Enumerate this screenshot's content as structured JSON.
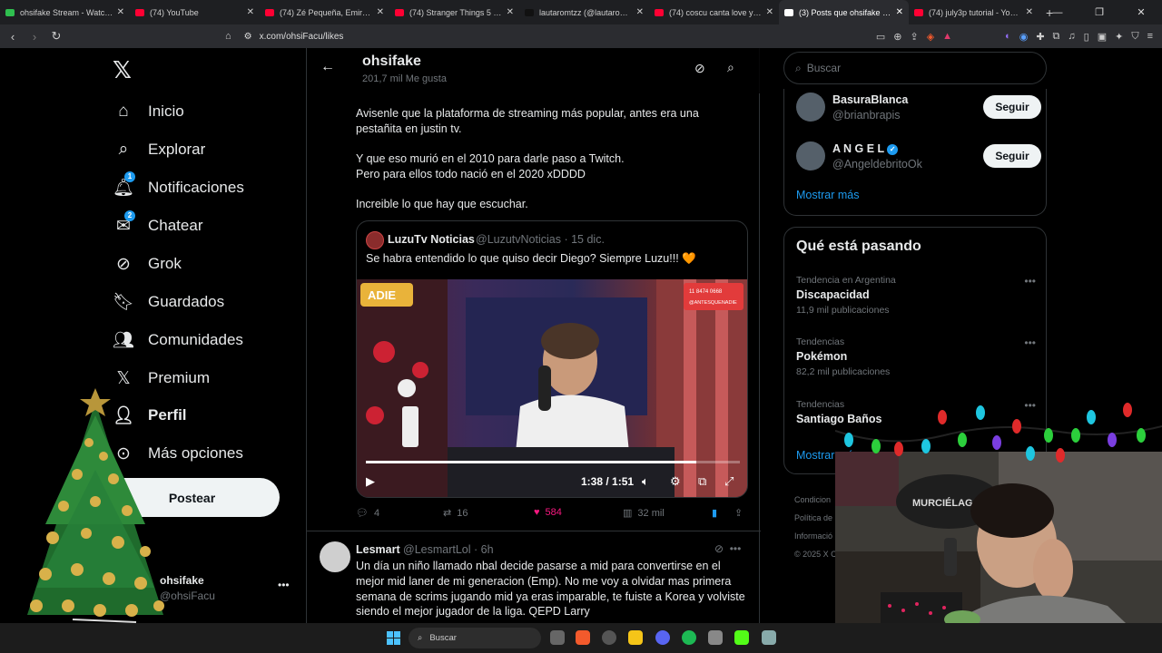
{
  "browser": {
    "tabs": [
      {
        "title": "ohsifake Stream - Watch Li",
        "color": "#2fbf4f",
        "active": false
      },
      {
        "title": "(74) YouTube",
        "color": "#ff0033",
        "active": false
      },
      {
        "title": "(74) Zé Pequeña, Emirsito - TW",
        "color": "#ff0033",
        "active": false
      },
      {
        "title": "(74) Stranger Things 5 | Tráiler",
        "color": "#ff0033",
        "active": false
      },
      {
        "title": "lautaromtzz (@lautaromtzz) | T",
        "color": "#111111",
        "active": false
      },
      {
        "title": "(74) coscu canta love yourself",
        "color": "#ff0033",
        "active": false
      },
      {
        "title": "(3) Posts que ohsifake (@o",
        "color": "#ffffff",
        "active": true
      },
      {
        "title": "(74) july3p tutorial - YouTube",
        "color": "#ff0033",
        "active": false
      }
    ],
    "url": "x.com/ohsiFacu/likes"
  },
  "nav": {
    "items": [
      {
        "label": "Inicio",
        "icon": "home-icon",
        "badge": ""
      },
      {
        "label": "Explorar",
        "icon": "search-icon",
        "badge": ""
      },
      {
        "label": "Notificaciones",
        "icon": "bell-icon",
        "badge": "1"
      },
      {
        "label": "Chatear",
        "icon": "mail-icon",
        "badge": "2"
      },
      {
        "label": "Grok",
        "icon": "grok-icon",
        "badge": ""
      },
      {
        "label": "Guardados",
        "icon": "bookmark-icon",
        "badge": ""
      },
      {
        "label": "Comunidades",
        "icon": "people-icon",
        "badge": ""
      },
      {
        "label": "Premium",
        "icon": "x-icon",
        "badge": ""
      },
      {
        "label": "Perfil",
        "icon": "person-icon",
        "badge": ""
      },
      {
        "label": "Más opciones",
        "icon": "more-circle-icon",
        "badge": ""
      }
    ],
    "post_label": "Postear",
    "account": {
      "name": "ohsifake",
      "handle": "@ohsiFacu"
    }
  },
  "header": {
    "title": "ohsifake",
    "subtitle": "201,7 mil Me gusta"
  },
  "tweet1": {
    "lines": [
      "Avisenle que la plataforma de streaming más popular, antes era una",
      "pestañita en justin tv.",
      "",
      "Y que eso murió en el 2010 para darle paso a Twitch.",
      "Pero para ellos todo nació en el 2020 xDDDD",
      "",
      "Increible lo que hay que escuchar."
    ],
    "quote": {
      "name": "LuzuTv Noticias",
      "handle": "@LuzutvNoticias · 15 dic.",
      "text": "Se habra entendido lo que quiso decir Diego? Siempre Luzu!!! 🧡",
      "video_time": "1:38 / 1:51",
      "video_progress": 0.883,
      "overlay_phone": "11 8474 0668",
      "overlay_tag": "@ANTESQUENADIE",
      "overlay_logo": "ADIE"
    },
    "actions": {
      "replies": "4",
      "reposts": "16",
      "likes": "584",
      "views": "32 mil"
    }
  },
  "tweet2": {
    "name": "Lesmart",
    "handle": "@LesmartLol · 6h",
    "text": "Un día un niño llamado nbal decide pasarse a mid para convertirse en el mejor mid laner de mi generacion (Emp). No me voy a olvidar mas primera semana de scrims jugando mid ya eras imparable, te fuiste a Korea y volviste siendo el mejor jugador de la liga. QEPD Larry"
  },
  "sidebar": {
    "search_placeholder": "Buscar",
    "suggestions": [
      {
        "name": "BasuraBlanca",
        "handle": "@brianbrapis",
        "verified": false,
        "button": "Seguir"
      },
      {
        "name": "A N G E L",
        "handle": "@AngeldebritoOk",
        "verified": true,
        "button": "Seguir"
      }
    ],
    "show_more": "Mostrar más",
    "trends_title": "Qué está pasando",
    "trends": [
      {
        "context": "Tendencia en Argentina",
        "name": "Discapacidad",
        "posts": "11,9 mil publicaciones"
      },
      {
        "context": "Tendencias",
        "name": "Pokémon",
        "posts": "82,2 mil publicaciones"
      },
      {
        "context": "Tendencias",
        "name": "Santiago Baños",
        "posts": ""
      }
    ],
    "trends_more": "Mostrar más",
    "footer": [
      "Condicion",
      "Política de",
      "Informació",
      "© 2025 X C"
    ]
  },
  "overlay": {
    "webcam_shirt_text": "MURCIÉLAGO"
  },
  "taskbar": {
    "search_label": "Buscar"
  }
}
